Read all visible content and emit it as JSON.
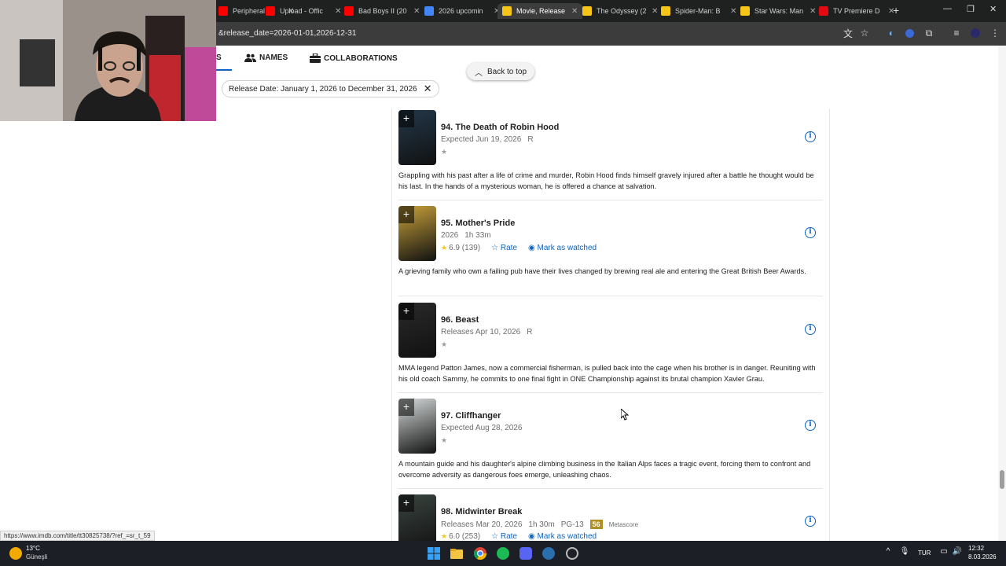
{
  "browser": {
    "tabs": [
      {
        "title": "Peripheral",
        "color": "#ff0000",
        "active": false
      },
      {
        "title": "Upload - Offic",
        "color": "#ff0000",
        "active": false
      },
      {
        "title": "Bad Boys II (20",
        "color": "#ff0000",
        "active": false
      },
      {
        "title": "2026 upcomin",
        "color": "#4285f4",
        "active": false
      },
      {
        "title": "Movie, Release",
        "color": "#f5c518",
        "active": true
      },
      {
        "title": "The Odyssey (2",
        "color": "#f5c518",
        "active": false
      },
      {
        "title": "Spider-Man: B",
        "color": "#f5c518",
        "active": false
      },
      {
        "title": "Star Wars: Man",
        "color": "#f5c518",
        "active": false
      },
      {
        "title": "TV Premiere D",
        "color": "#e50914",
        "active": false
      }
    ],
    "url": "&release_date=2026-01-01,2026-12-31",
    "status_url": "https://www.imdb.com/title/tt30825738/?ref_=sr_t_59"
  },
  "page": {
    "tabs": {
      "first_suffix": "S",
      "names": "NAMES",
      "collaborations": "COLLABORATIONS"
    },
    "back_to_top": "Back to top",
    "filter_chip": "Release Date: January 1, 2026 to December 31, 2026",
    "items": [
      {
        "title": "94. The Death of Robin Hood",
        "meta": [
          "Expected Jun 19, 2026",
          "R"
        ],
        "rating": "",
        "votes": "",
        "rate_label": "",
        "watched_label": "",
        "metascore": "",
        "metascore_label": "",
        "description": "Grappling with his past after a life of crime and murder, Robin Hood finds himself gravely injured after a battle he thought would be his last. In the hands of a mysterious woman, he is offered a chance at salvation.",
        "poster_color": "#23384a"
      },
      {
        "title": "95. Mother's Pride",
        "meta": [
          "2026",
          "1h 33m"
        ],
        "rating": "6.9",
        "votes": "(139)",
        "rate_label": "Rate",
        "watched_label": "Mark as watched",
        "metascore": "",
        "metascore_label": "",
        "description": "A grieving family who own a failing pub have their lives changed by brewing real ale and entering the Great British Beer Awards.",
        "poster_color": "#c9a23a"
      },
      {
        "title": "96. Beast",
        "meta": [
          "Releases Apr 10, 2026",
          "R"
        ],
        "rating": "",
        "votes": "",
        "rate_label": "",
        "watched_label": "",
        "metascore": "",
        "metascore_label": "",
        "description": "MMA legend Patton James, now a commercial fisherman, is pulled back into the cage when his brother is in danger. Reuniting with his old coach Sammy, he commits to one final fight in ONE Championship against its brutal champion Xavier Grau.",
        "poster_color": "#2a2a2a"
      },
      {
        "title": "97. Cliffhanger",
        "meta": [
          "Expected Aug 28, 2026"
        ],
        "rating": "",
        "votes": "",
        "rate_label": "",
        "watched_label": "",
        "metascore": "",
        "metascore_label": "",
        "description": "A mountain guide and his daughter's alpine climbing business in the Italian Alps faces a tragic event, forcing them to confront and overcome adversity as dangerous foes emerge, unleashing chaos.",
        "poster_color": "#d8dcdc"
      },
      {
        "title": "98. Midwinter Break",
        "meta": [
          "Releases Mar 20, 2026",
          "1h 30m",
          "PG-13"
        ],
        "rating": "6.0",
        "votes": "(253)",
        "rate_label": "Rate",
        "watched_label": "Mark as watched",
        "metascore": "56",
        "metascore_label": "Metascore",
        "description": "",
        "poster_color": "#3b4540"
      }
    ]
  },
  "taskbar": {
    "temperature": "13°C",
    "weather": "Güneşli",
    "language": "TUR",
    "time": "12:32",
    "date": "8.03.2026"
  },
  "colors": {
    "accent": "#0e63be",
    "imdb_yellow": "#f5c518",
    "metascore": "#b09021"
  }
}
